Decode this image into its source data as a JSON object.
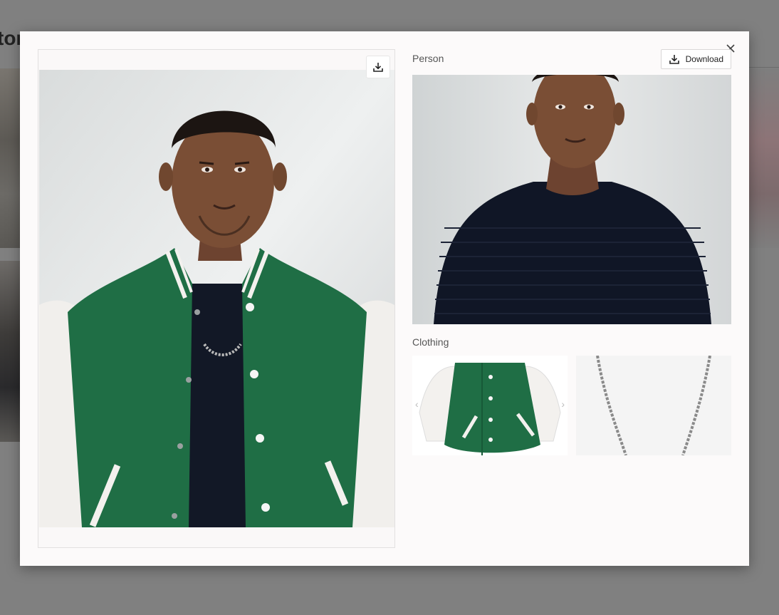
{
  "background": {
    "title_fragment": "tor"
  },
  "modal": {
    "close_label": "×",
    "main_image": {
      "alt": "Person wearing green varsity jacket with chain necklace",
      "download_icon": "download-icon"
    },
    "person": {
      "label": "Person",
      "download_label": "Download",
      "image_alt": "Person in black fitted long-sleeve top"
    },
    "clothing": {
      "label": "Clothing",
      "items": [
        {
          "alt": "Green varsity jacket with white sleeves"
        },
        {
          "alt": "Silver chain necklace"
        }
      ]
    }
  },
  "colors": {
    "jacket_green": "#1f6e45",
    "sleeve_white": "#f3f1ee",
    "shirt_black": "#101626",
    "skin": "#7a4e35",
    "wall": "#e4e6e6"
  }
}
